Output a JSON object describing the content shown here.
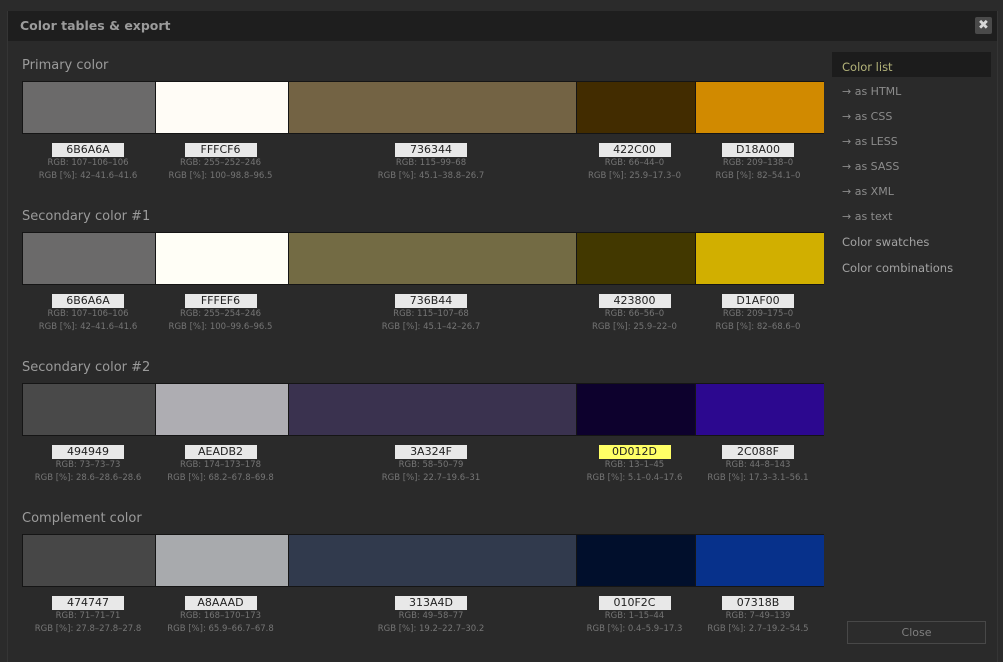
{
  "dialog": {
    "title": "Color tables & export",
    "close_symbol": "✖",
    "close_button": "Close"
  },
  "sections": [
    {
      "title": "Primary color",
      "swatches": [
        {
          "hex": "6B6A6A",
          "color": "#6B6A6A",
          "rgb": "RGB: 107–106–106",
          "rgb_pct": "RGB [%]: 42–41.6–41.6"
        },
        {
          "hex": "FFFCF6",
          "color": "#FFFCF6",
          "rgb": "RGB: 255–252–246",
          "rgb_pct": "RGB [%]: 100–98.8–96.5"
        },
        {
          "hex": "736344",
          "color": "#736344",
          "rgb": "RGB: 115–99–68",
          "rgb_pct": "RGB [%]: 45.1–38.8–26.7"
        },
        {
          "hex": "422C00",
          "color": "#422C00",
          "rgb": "RGB: 66–44–0",
          "rgb_pct": "RGB [%]: 25.9–17.3–0"
        },
        {
          "hex": "D18A00",
          "color": "#D18A00",
          "rgb": "RGB: 209–138–0",
          "rgb_pct": "RGB [%]: 82–54.1–0"
        }
      ]
    },
    {
      "title": "Secondary color #1",
      "swatches": [
        {
          "hex": "6B6A6A",
          "color": "#6B6A6A",
          "rgb": "RGB: 107–106–106",
          "rgb_pct": "RGB [%]: 42–41.6–41.6"
        },
        {
          "hex": "FFFEF6",
          "color": "#FFFEF6",
          "rgb": "RGB: 255–254–246",
          "rgb_pct": "RGB [%]: 100–99.6–96.5"
        },
        {
          "hex": "736B44",
          "color": "#736B44",
          "rgb": "RGB: 115–107–68",
          "rgb_pct": "RGB [%]: 45.1–42–26.7"
        },
        {
          "hex": "423800",
          "color": "#423800",
          "rgb": "RGB: 66–56–0",
          "rgb_pct": "RGB [%]: 25.9–22–0"
        },
        {
          "hex": "D1AF00",
          "color": "#D1AF00",
          "rgb": "RGB: 209–175–0",
          "rgb_pct": "RGB [%]: 82–68.6–0"
        }
      ]
    },
    {
      "title": "Secondary color #2",
      "swatches": [
        {
          "hex": "494949",
          "color": "#494949",
          "rgb": "RGB: 73–73–73",
          "rgb_pct": "RGB [%]: 28.6–28.6–28.6"
        },
        {
          "hex": "AEADB2",
          "color": "#AEADB2",
          "rgb": "RGB: 174–173–178",
          "rgb_pct": "RGB [%]: 68.2–67.8–69.8"
        },
        {
          "hex": "3A324F",
          "color": "#3A324F",
          "rgb": "RGB: 58–50–79",
          "rgb_pct": "RGB [%]: 22.7–19.6–31"
        },
        {
          "hex": "0D012D",
          "color": "#0D012D",
          "rgb": "RGB: 13–1–45",
          "rgb_pct": "RGB [%]: 5.1–0.4–17.6",
          "highlight": true
        },
        {
          "hex": "2C088F",
          "color": "#2C088F",
          "rgb": "RGB: 44–8–143",
          "rgb_pct": "RGB [%]: 17.3–3.1–56.1"
        }
      ]
    },
    {
      "title": "Complement color",
      "swatches": [
        {
          "hex": "474747",
          "color": "#474747",
          "rgb": "RGB: 71–71–71",
          "rgb_pct": "RGB [%]: 27.8–27.8–27.8"
        },
        {
          "hex": "A8AAAD",
          "color": "#A8AAAD",
          "rgb": "RGB: 168–170–173",
          "rgb_pct": "RGB [%]: 65.9–66.7–67.8"
        },
        {
          "hex": "313A4D",
          "color": "#313A4D",
          "rgb": "RGB: 49–58–77",
          "rgb_pct": "RGB [%]: 19.2–22.7–30.2"
        },
        {
          "hex": "010F2C",
          "color": "#010F2C",
          "rgb": "RGB: 1–15–44",
          "rgb_pct": "RGB [%]: 0.4–5.9–17.3"
        },
        {
          "hex": "07318B",
          "color": "#07318B",
          "rgb": "RGB: 7–49–139",
          "rgb_pct": "RGB [%]: 2.7–19.2–54.5"
        }
      ]
    }
  ],
  "sidebar": {
    "items": [
      {
        "label": "Color list",
        "type": "active"
      },
      {
        "label": "→ as HTML",
        "type": "sub"
      },
      {
        "label": "→ as CSS",
        "type": "sub"
      },
      {
        "label": "→ as LESS",
        "type": "sub"
      },
      {
        "label": "→ as SASS",
        "type": "sub"
      },
      {
        "label": "→ as XML",
        "type": "sub"
      },
      {
        "label": "→ as text",
        "type": "sub"
      },
      {
        "label": "Color swatches",
        "type": "main"
      },
      {
        "label": "Color combinations",
        "type": "main"
      }
    ]
  }
}
